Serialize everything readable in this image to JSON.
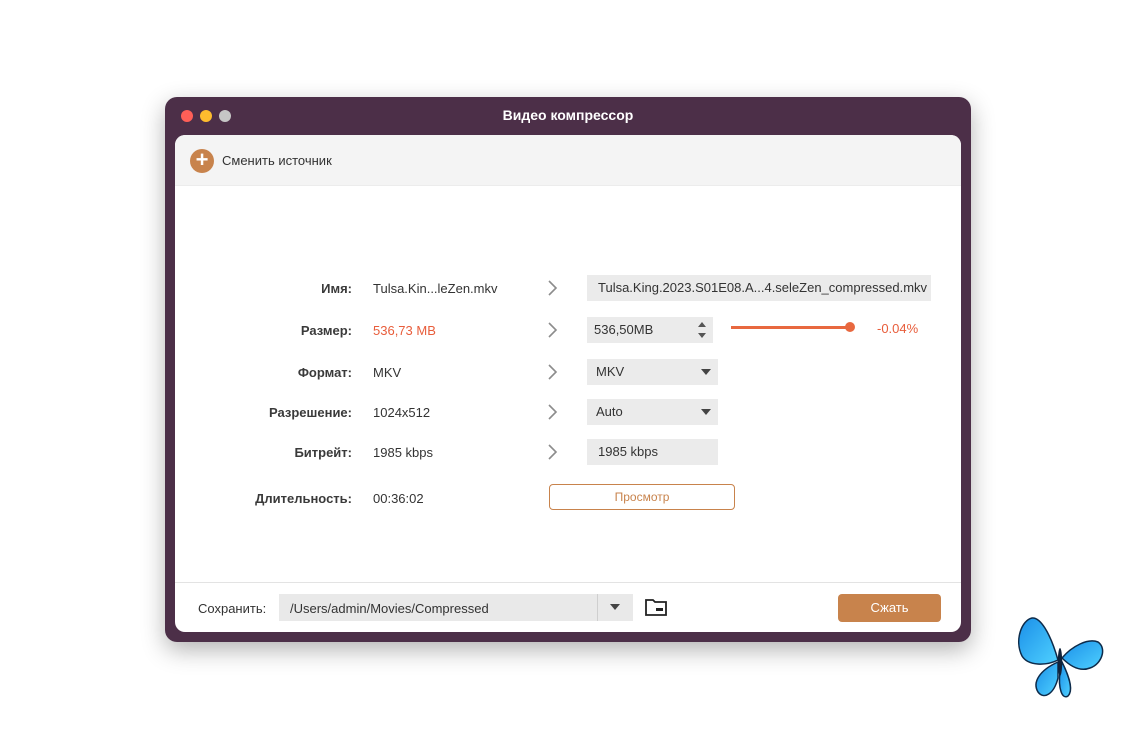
{
  "window": {
    "title": "Видео компрессор"
  },
  "toolbar": {
    "change_source_label": "Сменить источник"
  },
  "rows": {
    "name": {
      "label": "Имя:",
      "value": "Tulsa.Kin...leZen.mkv",
      "output": "Tulsa.King.2023.S01E08.A...4.seleZen_compressed.mkv"
    },
    "size": {
      "label": "Размер:",
      "value": "536,73 MB",
      "output": "536,50MB",
      "percent": "-0.04%",
      "slider_fraction": 1.0
    },
    "format": {
      "label": "Формат:",
      "value": "MKV",
      "output": "MKV"
    },
    "resolution": {
      "label": "Разрешение:",
      "value": "1024x512",
      "output": "Auto"
    },
    "bitrate": {
      "label": "Битрейт:",
      "value": "1985 kbps",
      "output": "1985 kbps"
    },
    "duration": {
      "label": "Длительность:",
      "value": "00:36:02"
    }
  },
  "preview": {
    "label": "Просмотр"
  },
  "save": {
    "label": "Сохранить:",
    "path": "/Users/admin/Movies/Compressed"
  },
  "compress": {
    "label": "Сжать"
  },
  "colors": {
    "accent": "#c8834c",
    "warning": "#e85d3b",
    "titlebar": "#4c2f48"
  },
  "icons": [
    "add-icon",
    "chevron-right-icon",
    "stepper-icon",
    "dropdown-caret-icon",
    "folder-icon",
    "butterfly-icon"
  ]
}
